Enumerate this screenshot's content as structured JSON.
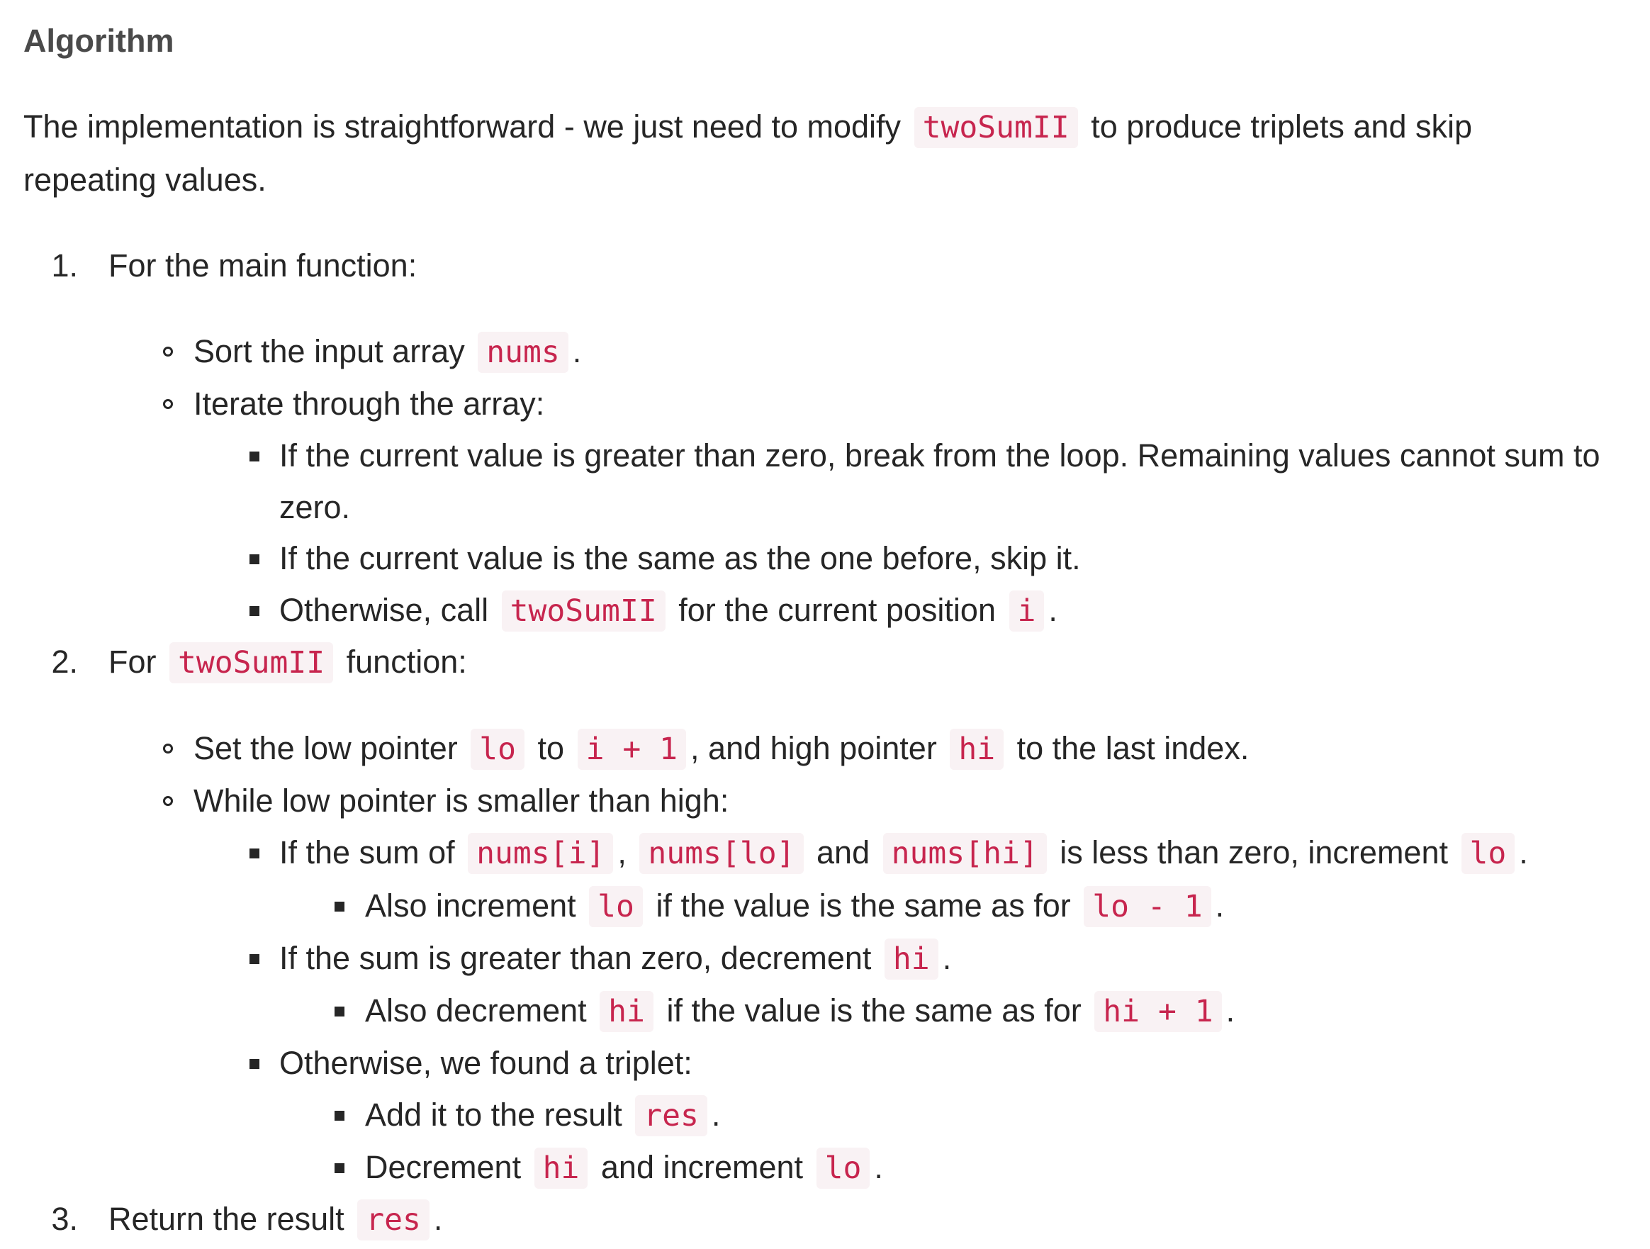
{
  "heading": "Algorithm",
  "intro": {
    "text_before": "The implementation is straightforward - we just need to modify",
    "code": "twoSumII",
    "text_after": "to produce triplets and skip repeating values."
  },
  "steps": {
    "s1": {
      "number": "1.",
      "text": "For the main function:"
    },
    "s1a": {
      "text": "Sort the input array",
      "code": "nums",
      "after": "."
    },
    "s1b": {
      "text": "Iterate through the array:"
    },
    "s1b1": {
      "line1": "If the current value is greater than zero, break from the loop. Remaining values cannot sum to",
      "line2": "zero."
    },
    "s1b2": {
      "text": "If the current value is the same as the one before, skip it."
    },
    "s1b3": {
      "text": "Otherwise, call",
      "code1": "twoSumII",
      "text2": "for the current position",
      "code2": "i",
      "after": "."
    },
    "s2": {
      "number": "2.",
      "text": "For",
      "code": "twoSumII",
      "text2": "function:"
    },
    "s2a": {
      "text": "Set the low pointer",
      "code1": "lo",
      "text2": "to",
      "code2": "i + 1",
      "text3": ", and high pointer",
      "code3": "hi",
      "text4": "to the last index."
    },
    "s2b": {
      "text": "While low pointer is smaller than high:"
    },
    "s2b1": {
      "text": "If the sum of",
      "code1": "nums[i]",
      "sep": ",",
      "code2": "nums[lo]",
      "text2": "and",
      "code3": "nums[hi]",
      "text3": "is less than zero, increment",
      "code4": "lo",
      "after": "."
    },
    "s2b1a": {
      "text": "Also increment",
      "code1": "lo",
      "text2": "if the value is the same as for",
      "code2": "lo - 1",
      "after": "."
    },
    "s2b2": {
      "text": "If the sum is greater than zero, decrement",
      "code": "hi",
      "after": "."
    },
    "s2b2a": {
      "text": "Also decrement",
      "code1": "hi",
      "text2": "if the value is the same as for",
      "code2": "hi + 1",
      "after": "."
    },
    "s2b3": {
      "text": "Otherwise, we found a triplet:"
    },
    "s2b3a": {
      "text": "Add it to the result",
      "code": "res",
      "after": "."
    },
    "s2b3b": {
      "text": "Decrement",
      "code1": "hi",
      "text2": "and increment",
      "code2": "lo",
      "after": "."
    },
    "s3": {
      "number": "3.",
      "text": "Return the result",
      "code": "res",
      "after": "."
    }
  },
  "colors": {
    "text": "#262626",
    "heading": "#4a4a4a",
    "code_text": "#c7254e",
    "code_bg": "#f9f2f4"
  }
}
